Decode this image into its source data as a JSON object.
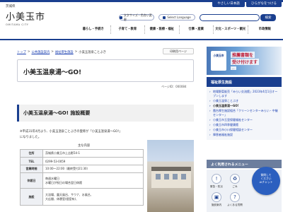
{
  "logo": {
    "prefecture": "茨城県",
    "city": "小美玉市",
    "romaji": "OMITAMA CITY"
  },
  "utility": {
    "font_size_label": "文字サイズ・色合い変更",
    "language_label": "Select Language",
    "easy_japanese": "やさしい日本語",
    "hiragana": "ひらがなをつける"
  },
  "search": {
    "placeholder": "",
    "button_label": "検索"
  },
  "global_nav": [
    "暮らし・手続き",
    "子育て・教育",
    "健康・医療・福祉",
    "仕事・産業",
    "文化・スポーツ・観光",
    "市政情報"
  ],
  "breadcrumb": {
    "items": [
      "トップ",
      "公共施設案内",
      "福祉厚生施設"
    ],
    "current": "小美玉温泉ことぶき"
  },
  "print_label": "印刷用ページ",
  "page": {
    "title": "小美玉温泉湯〜GO!",
    "page_id": "ページID：000084",
    "section_title": "小美玉温泉湯〜GO!  施設概要",
    "intro_line1": "※平成31年4月より、小美玉温泉ことぶきの愛称が「小美玉温泉湯〜GO!」",
    "intro_line2": "になりました。",
    "table_caption": "主な内容",
    "table": [
      {
        "key": "住所",
        "value": "茨城県小美玉市上吉影54-1"
      },
      {
        "key": "TEL",
        "value": "0299-53-0059"
      },
      {
        "key": "営業時間",
        "value": "10:00〜22:00（最終受付21:30）"
      },
      {
        "key": "休館日",
        "value": "毎週水曜日\n水曜日が祝日の場合翌日休館"
      },
      {
        "key": "施設",
        "value": "大浴場、露天風呂、サウナ、水風呂、\n大広間、休憩室(個室有)、"
      }
    ]
  },
  "sidebar": {
    "banner_badge": "小美玉市",
    "banner_line1": "推薦書類を",
    "banner_line2": "受け付けます",
    "banner_sub": "...",
    "section_title": "福祉厚生施設",
    "items": [
      {
        "label": "地場野菜販売「みらい交流館」2023年4月1日オープンします",
        "current": false
      },
      {
        "label": "小美玉温泉ことぶき",
        "current": false
      },
      {
        "label": "小美玉温泉湯〜GO!",
        "current": true
      },
      {
        "label": "霞台厚生施設組合「クリーンセンターみらい・中継センター」",
        "current": false
      },
      {
        "label": "小美玉市玉里保健福祉センター",
        "current": false
      },
      {
        "label": "小美玉市四季健康館",
        "current": false
      },
      {
        "label": "小美玉市小川保健相談センター",
        "current": false
      },
      {
        "label": "障害者福祉施設",
        "current": false
      }
    ]
  },
  "menu": {
    "title": "よく利用されるメニュー",
    "items": [
      "緊急・防災",
      "ごみ",
      "施設案内",
      "よくある質問"
    ]
  },
  "fab": {
    "line1": "質問して",
    "line2": "ください",
    "line3": "AIチャット"
  }
}
